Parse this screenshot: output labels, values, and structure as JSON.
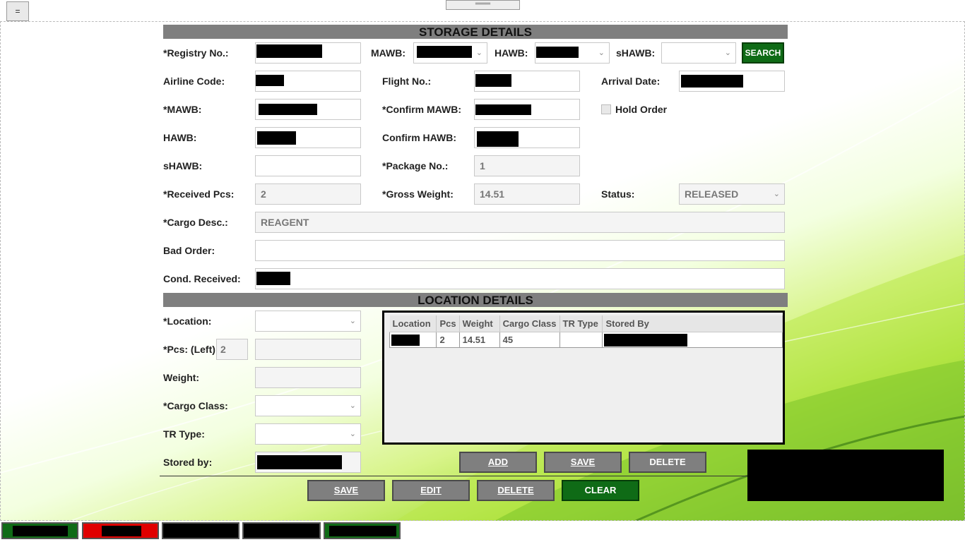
{
  "topbar": {
    "menu_label": "=",
    "grip_label": "═══"
  },
  "storage": {
    "title": "STORAGE DETAILS",
    "registry_label": "*Registry No.:",
    "mawb_label": "MAWB:",
    "hawb_label": "HAWB:",
    "shawb_label": "sHAWB:",
    "search_label": "SEARCH",
    "airline_label": "Airline Code:",
    "flight_label": "Flight No.:",
    "arrival_label": "Arrival Date:",
    "mawb2_label": "*MAWB:",
    "confirm_mawb_label": "*Confirm MAWB:",
    "hold_order_label": "Hold Order",
    "hawb2_label": "HAWB:",
    "confirm_hawb_label": "Confirm HAWB:",
    "shawb2_label": "sHAWB:",
    "package_label": "*Package No.:",
    "package_value": "1",
    "received_label": "*Received Pcs:",
    "received_value": "2",
    "gross_label": "*Gross Weight:",
    "gross_value": "14.51",
    "status_label": "Status:",
    "status_value": "RELEASED",
    "cargo_desc_label": "*Cargo Desc.:",
    "cargo_desc_value": "REAGENT",
    "bad_order_label": "Bad Order:",
    "cond_label": "Cond. Received:"
  },
  "location": {
    "title": "LOCATION DETAILS",
    "location_label": "*Location:",
    "pcs_label": "*Pcs: (Left):",
    "pcs_left_value": "2",
    "weight_label": "Weight:",
    "cargo_class_label": "*Cargo Class:",
    "tr_type_label": "TR Type:",
    "stored_by_label": "Stored by:",
    "grid_columns": [
      "Location",
      "Pcs",
      "Weight",
      "Cargo Class",
      "TR Type",
      "Stored By"
    ],
    "grid_rows": [
      {
        "location": "",
        "pcs": "2",
        "weight": "14.51",
        "cargo_class": "45",
        "tr_type": "",
        "stored_by": ""
      }
    ],
    "add_label": "ADD",
    "save_label": "SAVE",
    "delete_label": "DELETE"
  },
  "footer_buttons": {
    "save": "SAVE",
    "edit": "EDIT",
    "delete": "DELETE",
    "clear": "CLEAR"
  },
  "colors": {
    "accent_green": "#0f6b16",
    "section_gray": "#7f7f7f",
    "tab_red": "#e00000"
  }
}
